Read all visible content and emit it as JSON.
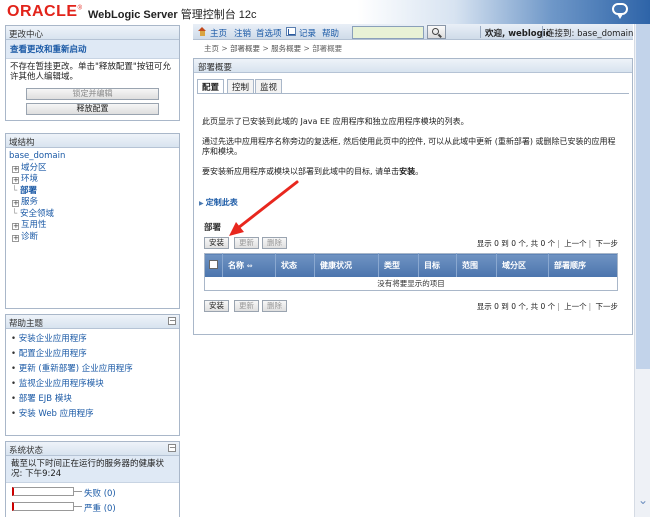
{
  "header": {
    "logo": "ORACLE",
    "product_bold": "WebLogic Server",
    "product_rest": " 管理控制台 12c"
  },
  "change_center": {
    "title": "更改中心",
    "link": "查看更改和重新启动",
    "description": "不存在暂挂更改。单击\"释放配置\"按钮可允许其他人编辑域。",
    "lock_button": "锁定并编辑",
    "release_button": "释放配置"
  },
  "domain_structure": {
    "title": "域结构",
    "root": "base_domain",
    "items": [
      {
        "label": "域分区",
        "expandable": true
      },
      {
        "label": "环境",
        "expandable": true
      },
      {
        "label": "部署",
        "expandable": false,
        "selected": true
      },
      {
        "label": "服务",
        "expandable": true
      },
      {
        "label": "安全领域",
        "expandable": false
      },
      {
        "label": "互用性",
        "expandable": true
      },
      {
        "label": "诊断",
        "expandable": true
      }
    ]
  },
  "help_topics": {
    "title": "帮助主题",
    "items": [
      "安装企业应用程序",
      "配置企业应用程序",
      "更新 (重新部署) 企业应用程序",
      "监视企业应用程序模块",
      "部署 EJB 模块",
      "安装 Web 应用程序"
    ]
  },
  "system_status": {
    "title": "系统状态",
    "description": "截至以下时间正在运行的服务器的健康状况: 下午9:24",
    "rows": [
      {
        "label": "失败 (0)"
      },
      {
        "label": "严重 (0)"
      }
    ]
  },
  "topnav": {
    "home": "主页",
    "logout": "注销",
    "preferences": "首选项",
    "record": "记录",
    "help": "帮助",
    "search_value": "",
    "welcome": "欢迎, weblogic",
    "connected": "连接到: base_domain"
  },
  "breadcrumb": [
    "主页",
    "部署概要",
    "服务概要",
    "部署概要"
  ],
  "content": {
    "title": "部署概要",
    "tabs": [
      "配置",
      "控制",
      "监视"
    ],
    "active_tab": "配置",
    "desc1": "此页显示了已安装到此域的 Java EE 应用程序和独立应用程序模块的列表。",
    "desc2": "通过先选中应用程序名称旁边的复选框, 然后使用此页中的控件, 可以从此域中更新 (重新部署) 或删除已安装的应用程序和模块。",
    "desc3_pre": "要安装新应用程序或模块以部署到此域中的目标, 请单击",
    "desc3_bold": "安装",
    "desc3_post": "。",
    "customize_link": "定制此表",
    "section_label": "部署",
    "toolbar": {
      "install": "安装",
      "update": "更新",
      "delete": "删除"
    },
    "pager": {
      "showing": "显示 0 到 0 个, 共 0 个",
      "prev": "上一个",
      "next": "下一步"
    },
    "table": {
      "columns": [
        "名称",
        "状态",
        "健康状况",
        "类型",
        "目标",
        "范围",
        "域分区",
        "部署顺序"
      ],
      "empty_message": "没有将要显示的项目"
    }
  },
  "colors": {
    "oracle_red": "#e2231a",
    "link_blue": "#1b5aa6",
    "table_header": "#5a80b6",
    "annotation_arrow": "#e8271e"
  }
}
